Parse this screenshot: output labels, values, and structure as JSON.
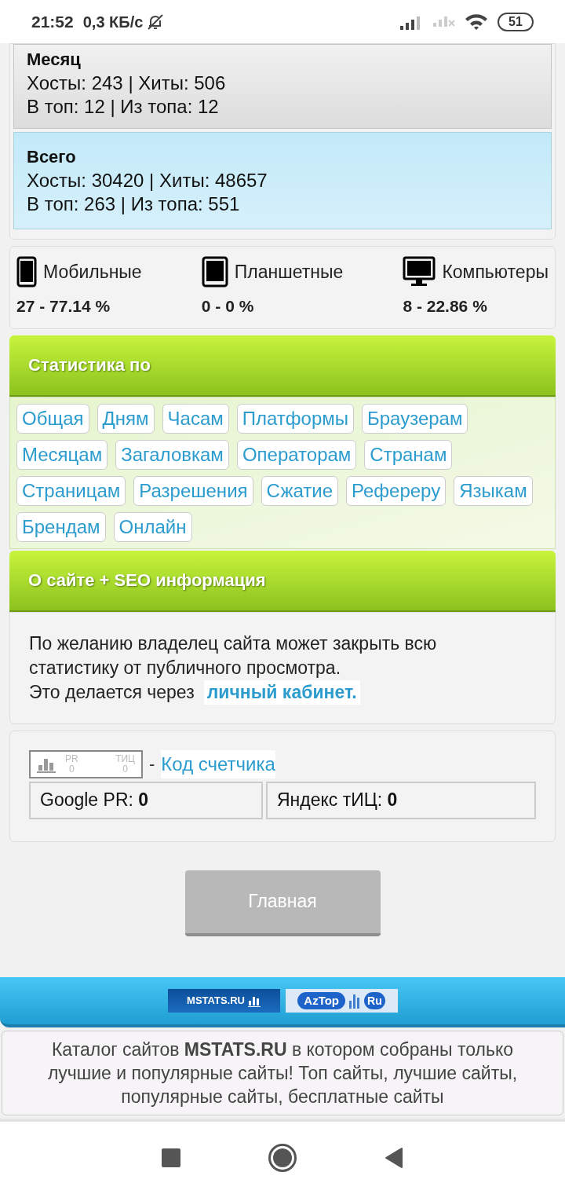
{
  "status_bar": {
    "time": "21:52",
    "speed": "0,3 КБ/с",
    "battery": "51"
  },
  "periods": [
    {
      "title": "Месяц",
      "line1": "Хосты: 243 | Хиты: 506",
      "line2": "В топ: 12 | Из топа: 12",
      "selected": false
    },
    {
      "title": "Всего",
      "line1": "Хосты: 30420 | Хиты: 48657",
      "line2": "В топ: 263 | Из топа: 551",
      "selected": true
    }
  ],
  "devices": [
    {
      "kind": "phone",
      "label": "Мобильные",
      "value": "27 - 77.14 %"
    },
    {
      "kind": "tablet",
      "label": "Планшетные",
      "value": "0 - 0 %"
    },
    {
      "kind": "desktop",
      "label": "Компьютеры",
      "value": "8 - 22.86 %"
    }
  ],
  "stats_header": "Статистика по",
  "stats_links": [
    "Общая",
    "Дням",
    "Часам",
    "Платформы",
    "Браузерам",
    "Месяцам",
    "Загаловкам",
    "Операторам",
    "Странам",
    "Страницам",
    "Разрешения",
    "Сжатие",
    "Рефереру",
    "Языкам",
    "Брендам",
    "Онлайн"
  ],
  "seo_header": "О сайте + SEO информация",
  "seo_text": "По желанию владелец сайта может закрыть всю статистику от публичного просмотра.",
  "seo_text2": "Это делается через",
  "seo_link": "личный кабинет.",
  "counter": {
    "dash": "-",
    "pr_label": "PR",
    "pr_value": "0",
    "tic_label": "ТИЦ",
    "tic_value": "0",
    "link": "Код счетчика"
  },
  "ranks": [
    {
      "label": "Google PR:",
      "value": "0"
    },
    {
      "label": "Яндекс тИЦ:",
      "value": "0"
    }
  ],
  "main_button": "Главная",
  "banners": {
    "mstats": "MSTATS.RU",
    "aztop": "AzTop",
    "ru": "Ru"
  },
  "footer": "Каталог сайтов **MSTATS.RU** в котором собраны только лучшие и популярные сайты! Топ сайты, лучшие сайты, популярные сайты, бесплатные сайты"
}
